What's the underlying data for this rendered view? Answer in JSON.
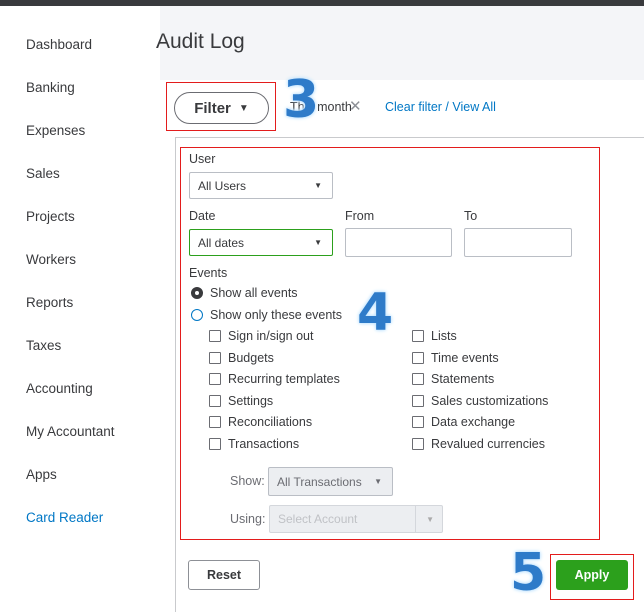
{
  "sidebar": {
    "items": [
      "Dashboard",
      "Banking",
      "Expenses",
      "Sales",
      "Projects",
      "Workers",
      "Reports",
      "Taxes",
      "Accounting",
      "My Accountant",
      "Apps",
      "Card Reader"
    ]
  },
  "page": {
    "title": "Audit Log"
  },
  "filter": {
    "button": "Filter",
    "chip": "This month",
    "clear": "Clear filter / View All"
  },
  "steps": [
    "3",
    "4",
    "5"
  ],
  "form": {
    "user_label": "User",
    "user_value": "All Users",
    "date_label": "Date",
    "date_value": "All dates",
    "from_label": "From",
    "to_label": "To",
    "events_label": "Events",
    "radio_all": "Show all events",
    "radio_only": "Show only these events",
    "events_left": [
      "Sign in/sign out",
      "Budgets",
      "Recurring templates",
      "Settings",
      "Reconciliations",
      "Transactions"
    ],
    "events_right": [
      "Lists",
      "Time events",
      "Statements",
      "Sales customizations",
      "Data exchange",
      "Revalued currencies"
    ],
    "show_label": "Show:",
    "show_value": "All Transactions",
    "using_label": "Using:",
    "using_placeholder": "Select Account"
  },
  "buttons": {
    "reset": "Reset",
    "apply": "Apply"
  },
  "colors": {
    "apply": "#2ca01c",
    "link": "#0077c5",
    "highlight": "#e31c1c"
  }
}
